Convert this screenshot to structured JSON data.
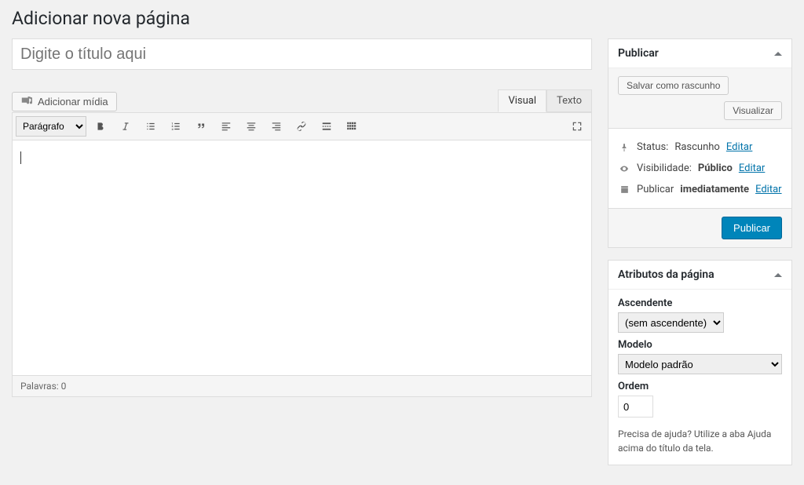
{
  "page": {
    "heading": "Adicionar nova página",
    "title_placeholder": "Digite o título aqui"
  },
  "media": {
    "add_label": "Adicionar mídia"
  },
  "editor": {
    "tabs": {
      "visual": "Visual",
      "text": "Texto"
    },
    "format": "Parágrafo",
    "word_count_label": "Palavras: 0"
  },
  "publish": {
    "box_title": "Publicar",
    "save_draft": "Salvar como rascunho",
    "preview": "Visualizar",
    "status_label": "Status:",
    "status_value": "Rascunho",
    "visibility_label": "Visibilidade:",
    "visibility_value": "Público",
    "schedule_label": "Publicar",
    "schedule_value": "imediatamente",
    "edit": "Editar",
    "submit": "Publicar"
  },
  "attributes": {
    "box_title": "Atributos da página",
    "parent_label": "Ascendente",
    "parent_value": "(sem ascendente)",
    "template_label": "Modelo",
    "template_value": "Modelo padrão",
    "order_label": "Ordem",
    "order_value": "0",
    "help": "Precisa de ajuda? Utilize a aba Ajuda acima do título da tela."
  }
}
